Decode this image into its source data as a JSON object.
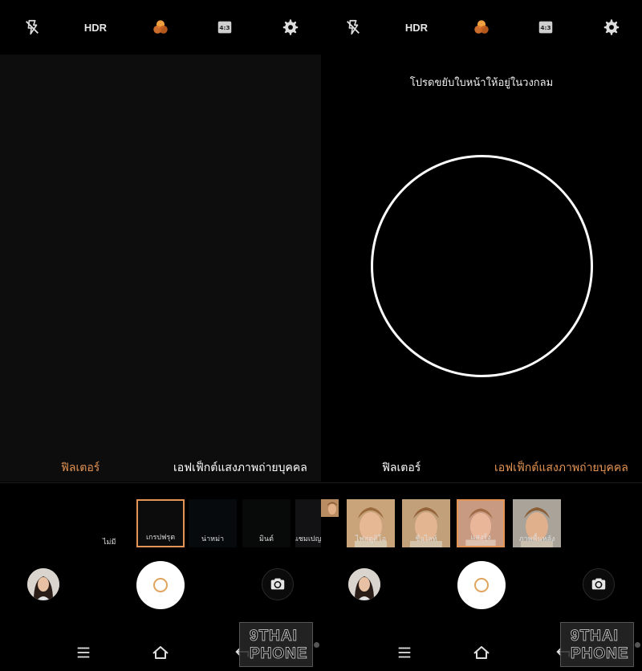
{
  "colors": {
    "accent": "#e49454",
    "shutter_ring": "#e0a45c"
  },
  "topbar": {
    "icons": [
      "flash-off-icon",
      "filter-icon",
      "aspect-ratio-icon",
      "gear-icon"
    ],
    "hdr_label": "HDR",
    "ratio_label": "4:3"
  },
  "left": {
    "tabs": {
      "filter": "ฟิลเตอร์",
      "portrait": "เอฟเฟ็กต์แสงภาพถ่ายบุคคล"
    },
    "active_tab": "filter",
    "filters": [
      {
        "label": "ไม่มี"
      },
      {
        "label": "เกรปฟรุต",
        "selected": true
      },
      {
        "label": "น่าหม่า"
      },
      {
        "label": "มินต์"
      },
      {
        "label": "แชมเปญ"
      }
    ]
  },
  "right": {
    "instruction": "โปรดขยับใบหน้าให้อยู่ในวงกลม",
    "tabs": {
      "filter": "ฟิลเตอร์",
      "portrait": "เอฟเฟ็กต์แสงภาพถ่ายบุคคล"
    },
    "active_tab": "portrait",
    "effects": [
      {
        "label": "ไฟสตูดิโอ"
      },
      {
        "label": "ชื่อไลท์"
      },
      {
        "label": "แสงรุ้ง",
        "selected": true
      },
      {
        "label": "ภาพพื้นหลัง"
      }
    ]
  },
  "watermark": {
    "line1": "9THAI",
    "line2": "PHONE"
  }
}
